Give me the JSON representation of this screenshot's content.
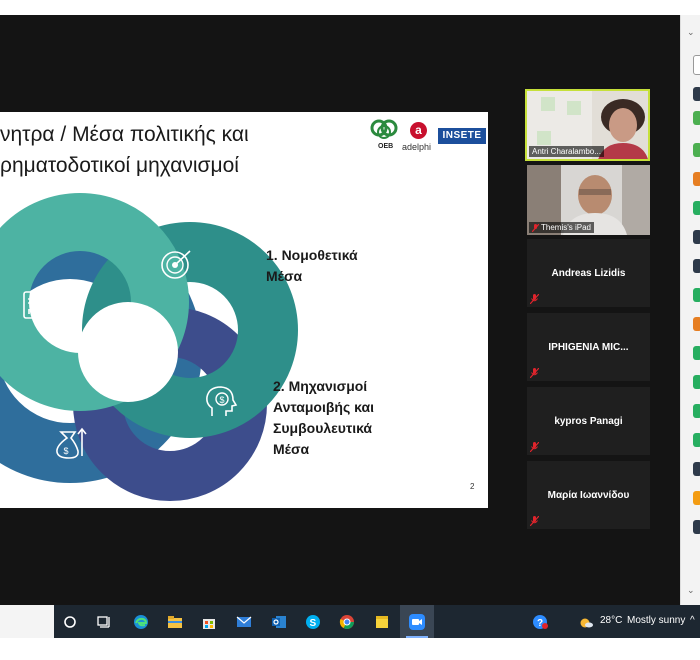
{
  "slide": {
    "title_line1": "νητρα / Μέσα πολιτικής και",
    "title_line2": "ρηματοδοτικοί μηχανισμοί",
    "logos": {
      "oeb": "OEB",
      "adelphi_mark": "a",
      "adelphi": "adelphi",
      "insete": "INSETE"
    },
    "item1": [
      "1. Νομοθετικά",
      "Μέσα"
    ],
    "item2": [
      "2. Μηχανισμοί",
      "Ανταμοιβής και",
      "Συμβουλευτικά",
      "Μέσα"
    ],
    "page_number": "2"
  },
  "participants": [
    {
      "name": "Antri Charalambo...",
      "type": "video",
      "highlighted": true
    },
    {
      "name": "Themis's iPad",
      "type": "video",
      "highlighted": false
    },
    {
      "name": "Andreas Lizidis",
      "type": "name",
      "muted": true
    },
    {
      "name": "IPHIGENIA  MIC...",
      "type": "name",
      "muted": true
    },
    {
      "name": "kypros Panagi",
      "type": "name",
      "muted": true
    },
    {
      "name": "Μαρία Ιωαννίδου",
      "type": "name",
      "muted": true
    }
  ],
  "taskbar": {
    "weather_temp": "28°C",
    "weather_text": "Mostly sunny",
    "apps": [
      "search-icon",
      "task-view-icon",
      "edge-icon",
      "file-explorer-icon",
      "store-icon",
      "mail-icon",
      "outlook-icon",
      "skype-icon",
      "chrome-icon",
      "sticky-notes-icon",
      "zoom-icon"
    ]
  },
  "colors": {
    "accent_highlight": "#c6e03a",
    "mute_red": "#e0242c",
    "taskbar": "#1d2731"
  }
}
